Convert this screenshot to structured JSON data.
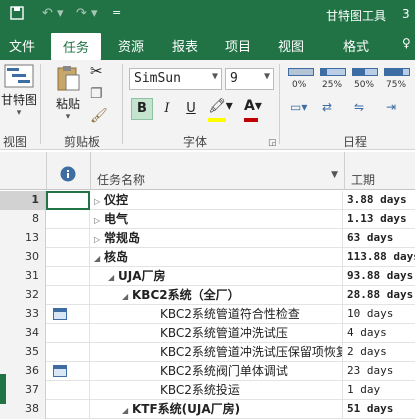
{
  "titlebar": {
    "context_label": "甘特图工具",
    "right_label": "3"
  },
  "tabs": [
    {
      "label": "文件"
    },
    {
      "label": "任务"
    },
    {
      "label": "资源"
    },
    {
      "label": "报表"
    },
    {
      "label": "项目"
    },
    {
      "label": "视图"
    },
    {
      "label": "格式"
    }
  ],
  "ribbon": {
    "view_button": "甘特图",
    "view_group": "视图",
    "paste_button": "粘贴",
    "clipboard_group": "剪贴板",
    "font_name": "SimSun",
    "font_size": "9",
    "bold": "B",
    "italic": "I",
    "underline": "U",
    "font_group": "字体",
    "schedule_group": "日程",
    "progress_labels": [
      "0%",
      "25%",
      "50%",
      "75%",
      "100%"
    ]
  },
  "colors": {
    "brand": "#217346",
    "font_color_bar": "#c00000",
    "highlight_bar": "#ffff00"
  },
  "grid": {
    "col_info_icon": "info-icon",
    "col_name": "任务名称",
    "col_duration": "工期",
    "rows": [
      {
        "id": "1",
        "name": "仪控",
        "duration": "3.88 days",
        "selected": true
      },
      {
        "id": "8",
        "name": "电气",
        "duration": "1.13 days"
      },
      {
        "id": "13",
        "name": "常规岛",
        "duration": "63 days"
      },
      {
        "id": "30",
        "name": "核岛",
        "duration": "113.88 days"
      },
      {
        "id": "31",
        "name": "UJA厂房",
        "duration": "93.88 days"
      },
      {
        "id": "32",
        "name": "KBC2系统（全厂）",
        "duration": "28.88 days"
      },
      {
        "id": "33",
        "name": "KBC2系统管道符合性检查",
        "duration": "10 days"
      },
      {
        "id": "34",
        "name": "KBC2系统管道冲洗试压",
        "duration": "4 days"
      },
      {
        "id": "35",
        "name": "KBC2系统管道冲洗试压保留项恢复",
        "duration": "2 days"
      },
      {
        "id": "36",
        "name": "KBC2系统阀门单体调试",
        "duration": "23 days"
      },
      {
        "id": "37",
        "name": "KBC2系统投运",
        "duration": "1 day"
      },
      {
        "id": "38",
        "name": "KTF系统(UJA厂房)",
        "duration": "51 days"
      }
    ]
  }
}
